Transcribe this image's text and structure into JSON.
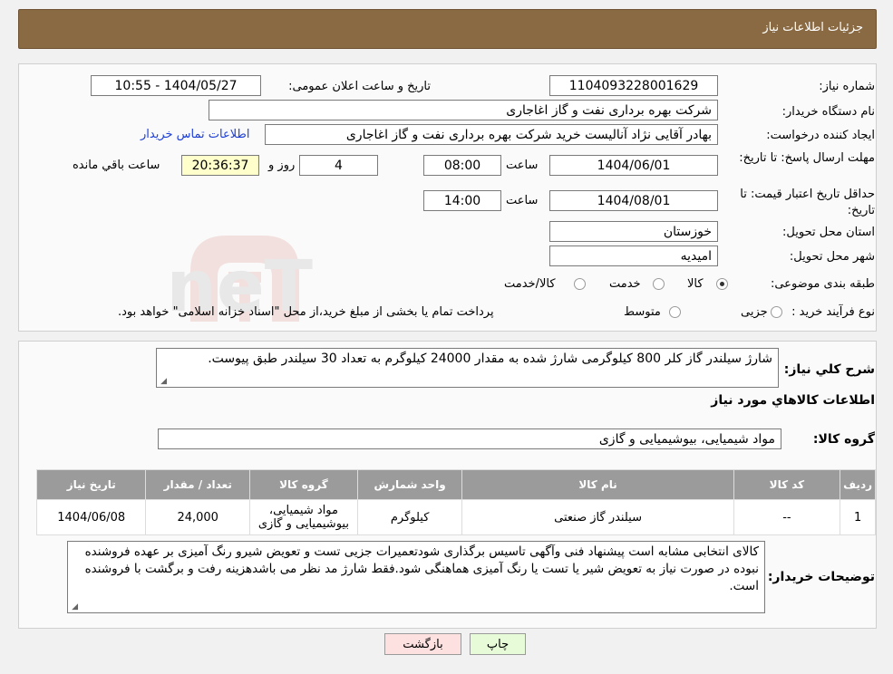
{
  "header": {
    "title": "جزئیات اطلاعات نیاز"
  },
  "form": {
    "need_number_label": "شماره نیاز:",
    "need_number": "1104093228001629",
    "announce_label": "تاریخ و ساعت اعلان عمومی:",
    "announce_value": "1404/05/27 - 10:55",
    "buyer_org_label": "نام دستگاه خریدار:",
    "buyer_org": "شرکت بهره برداری نفت و گاز اغاجاری",
    "creator_label": "ایجاد کننده درخواست:",
    "creator": "بهادر  آقایی نژاد آنالیست خرید شرکت بهره برداری نفت و گاز اغاجاری",
    "contact_link": "اطلاعات تماس خریدار",
    "deadline_label": "مهلت ارسال پاسخ: تا تاریخ:",
    "deadline_date": "1404/06/01",
    "time_label": "ساعت",
    "deadline_time": "08:00",
    "days_value": "4",
    "days_label": "روز و",
    "remaining_time": "20:36:37",
    "remaining_label": "ساعت باقي مانده",
    "validity_label": "حداقل تاریخ اعتبار قیمت: تا تاریخ:",
    "validity_date": "1404/08/01",
    "validity_time": "14:00",
    "province_label": "استان محل تحویل:",
    "province": "خوزستان",
    "city_label": "شهر محل تحویل:",
    "city": "امیدیه",
    "category_label": "طبقه بندی موضوعی:",
    "category_options": [
      "کالا",
      "خدمت",
      "کالا/خدمت"
    ],
    "process_label": "نوع فرآیند خرید :",
    "process_options": [
      "جزیی",
      "متوسط"
    ],
    "process_note": "پرداخت تمام یا بخشی از مبلغ خرید،از محل \"اسناد خزانه اسلامی\" خواهد بود."
  },
  "summary": {
    "label": "شرح کلي نياز:",
    "text": "شارژ سیلندر گاز کلر 800 کیلوگرمی شارژ شده به مقدار 24000 کیلوگرم به تعداد 30 سیلندر طبق پیوست.",
    "goods_info_title": "اطلاعات کالاهاي مورد نياز",
    "group_label": "گروه کالا:",
    "group_value": "مواد شیمیایی، بیوشیمیایی و  گازی"
  },
  "table": {
    "headers": [
      "رديف",
      "کد کالا",
      "نام کالا",
      "واحد شمارش",
      "گروه کالا",
      "تعداد / مقدار",
      "تاریخ نیاز"
    ],
    "rows": [
      {
        "row": "1",
        "code": "--",
        "name": "سیلندر گاز صنعتی",
        "unit": "کیلوگرم",
        "group_line1": "مواد شیمیایی،",
        "group_line2": "بیوشیمیایی و گازی",
        "qty": "24,000",
        "date": "1404/06/08"
      }
    ]
  },
  "buyer_notes": {
    "label": "توضیحات خریدار:",
    "text": "کالای انتخابی مشابه است پیشنهاد فنی وآگهی تاسیس برگذاری شودتعمیرات جزیی  تست و تعویض شیرو رنگ آمیزی بر عهده فروشنده نبوده در صورت نیاز به تعویض شیر یا تست یا رنگ آمیزی هماهنگی شود.فقط شارژ مد نظر می باشدهزینه رفت و برگشت با فروشنده است."
  },
  "buttons": {
    "print": "چاپ",
    "back": "بازگشت"
  },
  "watermark": {
    "text": "AriaTender.neT"
  },
  "colors": {
    "header_bg": "#8a6a43",
    "table_header_bg": "#9b9b9b",
    "link": "#1d3fd8",
    "print_btn": "#e7fbd9",
    "back_btn": "#fde0e0"
  }
}
